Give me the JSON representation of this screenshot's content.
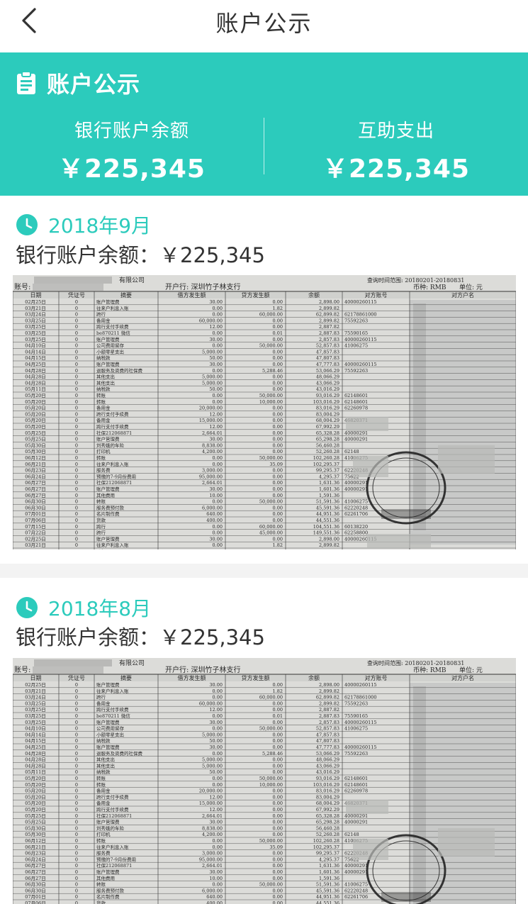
{
  "nav": {
    "title": "账户公示"
  },
  "summary": {
    "heading": "账户公示",
    "bank_balance_label": "银行账户余额",
    "bank_balance_value": "￥225,345",
    "expense_label": "互助支出",
    "expense_value": "￥225,345"
  },
  "months": [
    {
      "month": "2018年9月",
      "balance_label": "银行账户余额：",
      "balance_value": "￥225,345"
    },
    {
      "month": "2018年8月",
      "balance_label": "银行账户余额：",
      "balance_value": "￥225,345"
    }
  ],
  "statement": {
    "header_company": "有限公司",
    "account_label": "账号:",
    "branch": "开户行: 深圳竹子林支行",
    "currency": "币种: RMB",
    "unit": "单位: 元",
    "query_range": "查询时间范围: 20180201-20180831",
    "columns": [
      "日期",
      "凭证号",
      "摘要",
      "借方发生额",
      "贷方发生额",
      "余额",
      "对方账号",
      "对方户名"
    ],
    "rows": [
      [
        "02月25日",
        "0",
        "账户管理费",
        "30.00",
        "0.00",
        "2,898.00",
        "40000260115"
      ],
      [
        "03月21日",
        "0",
        "往来户利息入账",
        "0.00",
        "1.82",
        "2,899.82",
        ""
      ],
      [
        "03月24日",
        "0",
        "跨行",
        "0.00",
        "60,000.00",
        "62,899.82",
        "62178861000"
      ],
      [
        "03月25日",
        "0",
        "备用金",
        "60,000.00",
        "0.00",
        "2,899.82",
        "75592263"
      ],
      [
        "03月25日",
        "0",
        "跨行支付手续费",
        "12.00",
        "0.00",
        "2,887.82",
        ""
      ],
      [
        "03月25日",
        "0",
        "be870211 微信",
        "0.00",
        "0.01",
        "2,887.83",
        "75590165"
      ],
      [
        "03月25日",
        "0",
        "账户管理费",
        "30.00",
        "0.00",
        "2,857.83",
        "40000260115"
      ],
      [
        "04月10日",
        "0",
        "公司费用留存",
        "0.00",
        "50,000.00",
        "52,857.83",
        "41006275"
      ],
      [
        "04月14日",
        "0",
        "小额零星支出",
        "5,000.00",
        "0.00",
        "47,857.83",
        ""
      ],
      [
        "04月15日",
        "0",
        "纳税款",
        "50.00",
        "0.00",
        "47,807.83",
        ""
      ],
      [
        "04月25日",
        "0",
        "账户管理费",
        "30.00",
        "0.00",
        "47,777.83",
        "40000260115"
      ],
      [
        "04月28日",
        "0",
        "退服务及资费的社保费",
        "0.00",
        "5,288.46",
        "53,066.29",
        "75592263"
      ],
      [
        "04月28日",
        "0",
        "其他支出",
        "5,000.00",
        "0.00",
        "48,066.29",
        ""
      ],
      [
        "04月28日",
        "0",
        "其他支出",
        "5,000.00",
        "0.00",
        "43,066.29",
        ""
      ],
      [
        "05月11日",
        "0",
        "纳税款",
        "50.00",
        "0.00",
        "43,016.29",
        ""
      ],
      [
        "05月20日",
        "0",
        "转账",
        "0.00",
        "50,000.00",
        "93,016.29",
        "62148601"
      ],
      [
        "05月20日",
        "0",
        "转账",
        "0.00",
        "10,000.00",
        "103,016.29",
        "62148601"
      ],
      [
        "05月20日",
        "0",
        "备用金",
        "20,000.00",
        "0.00",
        "83,016.29",
        "62260978"
      ],
      [
        "05月20日",
        "0",
        "跨行支付手续费",
        "12.00",
        "0.00",
        "83,004.29",
        ""
      ],
      [
        "05月20日",
        "0",
        "备用金",
        "15,000.00",
        "0.00",
        "68,004.29",
        "46820371"
      ],
      [
        "05月20日",
        "0",
        "跨行支付手续费",
        "12.00",
        "0.00",
        "67,992.29",
        ""
      ],
      [
        "05月25日",
        "0",
        "社保212068871",
        "2,664.01",
        "0.00",
        "65,328.28",
        "40000291"
      ],
      [
        "05月25日",
        "0",
        "账户管理费",
        "30.00",
        "0.00",
        "65,298.28",
        "40000291"
      ],
      [
        "05月30日",
        "0",
        "刘秀娥的车险",
        "8,838.00",
        "0.00",
        "56,460.28",
        ""
      ],
      [
        "05月30日",
        "0",
        "打印机",
        "4,200.00",
        "0.00",
        "52,260.28",
        "62148"
      ],
      [
        "06月12日",
        "0",
        "转账",
        "0.00",
        "50,000.00",
        "102,260.28",
        "41006275"
      ],
      [
        "06月21日",
        "0",
        "往来户利息入账",
        "0.00",
        "35.09",
        "102,295.37",
        ""
      ],
      [
        "06月23日",
        "0",
        "服务费",
        "3,000.00",
        "0.00",
        "99,295.37",
        "62220248"
      ],
      [
        "06月24日",
        "0",
        "预缴的7-9月份费用",
        "95,000.00",
        "0.00",
        "4,295.37",
        "75622"
      ],
      [
        "06月27日",
        "0",
        "社保212068871",
        "2,664.01",
        "0.00",
        "1,631.36",
        "40000291"
      ],
      [
        "06月27日",
        "0",
        "账户管理费",
        "30.00",
        "0.00",
        "1,601.36",
        "40000291"
      ],
      [
        "06月27日",
        "0",
        "其他费用",
        "10.00",
        "0.00",
        "1,591.36",
        ""
      ],
      [
        "06月30日",
        "0",
        "转账",
        "0.00",
        "50,000.00",
        "51,591.36",
        "41006275"
      ],
      [
        "06月30日",
        "0",
        "服务费预付款",
        "6,000.00",
        "0.00",
        "45,591.36",
        "62220248"
      ],
      [
        "07月01日",
        "0",
        "名片制作费",
        "640.00",
        "0.00",
        "44,951.36",
        "62261706"
      ],
      [
        "07月06日",
        "0",
        "货款",
        "400.00",
        "0.00",
        "44,551.36",
        ""
      ],
      [
        "07月15日",
        "0",
        "跨行",
        "0.00",
        "60,000.00",
        "104,551.36",
        "60138220"
      ],
      [
        "07月22日",
        "0",
        "跨行",
        "0.00",
        "45,000.00",
        "149,551.36",
        "62258800"
      ]
    ]
  }
}
